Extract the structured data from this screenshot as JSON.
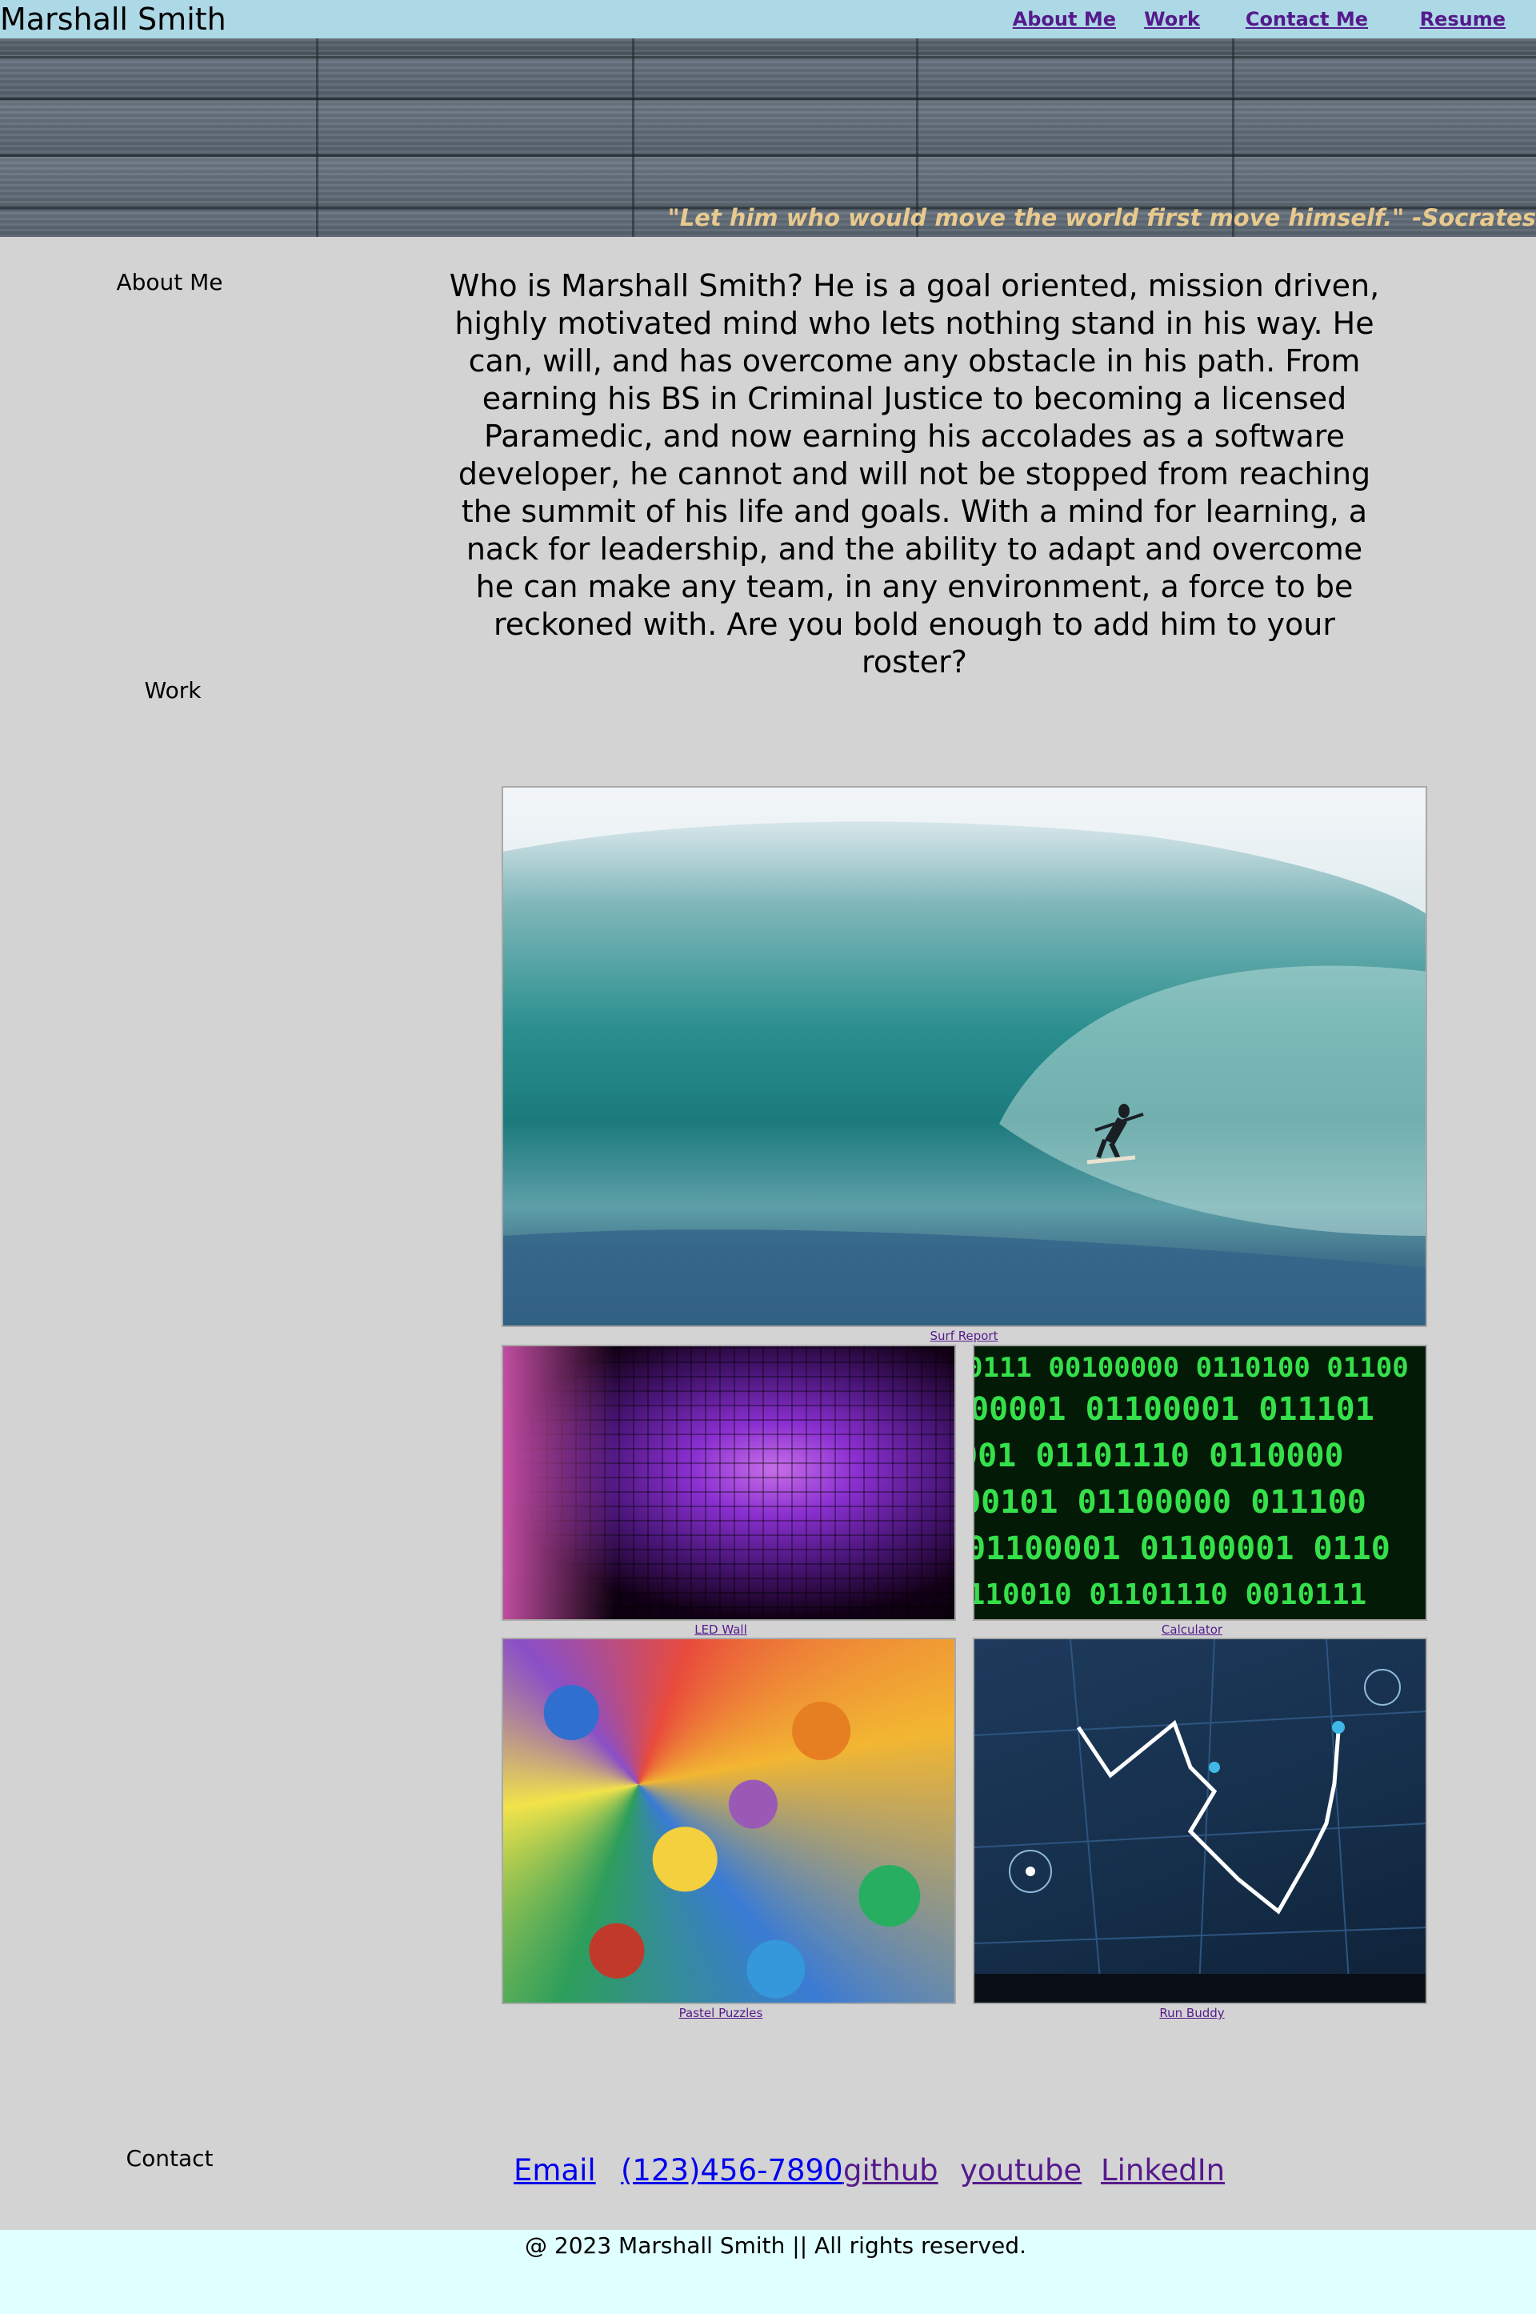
{
  "header": {
    "site_name": "Marshall Smith",
    "nav": [
      "About Me",
      "Work",
      "Contact Me",
      "Resume"
    ]
  },
  "hero": {
    "quote": "\"Let him who would move the world first move himself.\" -Socrates"
  },
  "about": {
    "label": "About Me",
    "text": "Who is Marshall Smith? He is a goal oriented, mission driven, highly motivated mind who lets nothing stand in his way. He can, will, and has overcome any obstacle in his path. From earning his BS in Criminal Justice to becoming a licensed Paramedic, and now earning his accolades as a software developer, he cannot and will not be stopped from reaching the summit of his life and goals. With a mind for learning, a nack for leadership, and the ability to adapt and overcome he can make any team, in any environment, a force to be reckoned with. Are you bold enough to add him to your roster?"
  },
  "work": {
    "label": "Work",
    "projects": [
      {
        "title": "Surf Report",
        "image": "surf-wave-image"
      },
      {
        "title": "LED Wall",
        "image": "led-wall-image"
      },
      {
        "title": "Calculator",
        "image": "binary-code-image"
      },
      {
        "title": "Pastel Puzzles",
        "image": "puzzle-pieces-image"
      },
      {
        "title": "Run Buddy",
        "image": "map-navigation-image"
      }
    ]
  },
  "contact": {
    "label": "Contact",
    "links": [
      "Email",
      "(123)456-7890",
      "github",
      "youtube",
      "LinkedIn"
    ]
  },
  "footer": {
    "text": "@ 2023 Marshall Smith || All rights reserved."
  },
  "colors": {
    "header_bg": "#add8e6",
    "page_bg": "#d3d3d3",
    "footer_bg": "#e0ffff",
    "quote": "#e8c98e",
    "link_visited": "#551a8b",
    "link_unvisited": "#0000ee"
  }
}
